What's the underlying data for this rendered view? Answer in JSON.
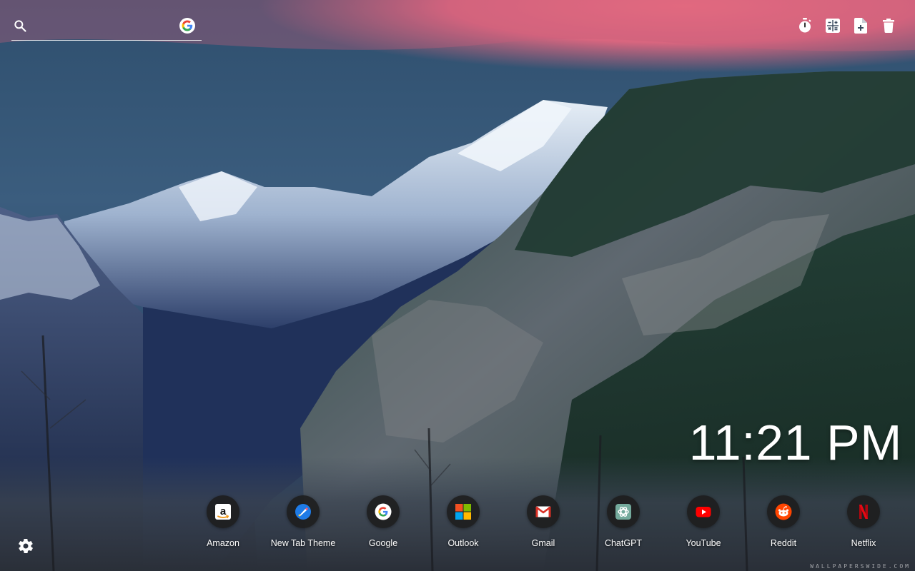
{
  "search": {
    "value": "",
    "placeholder": "",
    "icon": "search-icon",
    "engine_icon": "google-icon"
  },
  "toolbar": {
    "items": [
      {
        "icon": "timer-icon"
      },
      {
        "icon": "calculator-icon"
      },
      {
        "icon": "add-note-icon"
      },
      {
        "icon": "trash-icon"
      }
    ]
  },
  "clock": {
    "time": "11:21 PM"
  },
  "shortcuts": [
    {
      "label": "Amazon",
      "icon": "amazon-icon"
    },
    {
      "label": "New Tab Theme",
      "icon": "new-tab-theme-icon"
    },
    {
      "label": "Google",
      "icon": "google-icon"
    },
    {
      "label": "Outlook",
      "icon": "microsoft-icon"
    },
    {
      "label": "Gmail",
      "icon": "gmail-icon"
    },
    {
      "label": "ChatGPT",
      "icon": "chatgpt-icon"
    },
    {
      "label": "YouTube",
      "icon": "youtube-icon"
    },
    {
      "label": "Reddit",
      "icon": "reddit-icon"
    },
    {
      "label": "Netflix",
      "icon": "netflix-icon"
    }
  ],
  "settings": {
    "icon": "gear-icon"
  },
  "credit": "WALLPAPERSWIDE.COM",
  "colors": {
    "sky_pink": "#e8677a",
    "sky_blue": "#3a5d7c",
    "snow": "#dfe8f2",
    "rock": "#6b7078",
    "forest": "#1f3a33",
    "tile_bg": "#1c1c1c"
  }
}
